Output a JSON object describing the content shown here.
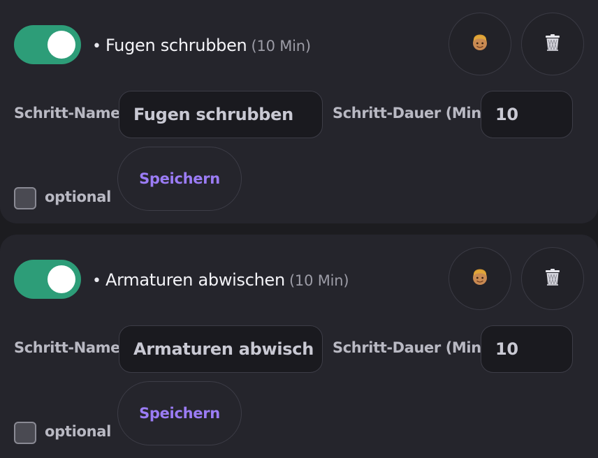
{
  "steps": [
    {
      "enabled": true,
      "title": "Fugen schrubben",
      "duration_text": "(10 Min)",
      "name_label": "Schritt-Name",
      "name_value": "Fugen schrubben",
      "duration_label": "Schritt-Dauer (Min)",
      "duration_value": "10",
      "save_label": "Speichern",
      "optional_label": "optional",
      "optional_checked": false,
      "avatar_icon": "person-avatar-icon",
      "delete_icon": "trash-icon"
    },
    {
      "enabled": true,
      "title": "Armaturen abwischen",
      "duration_text": "(10 Min)",
      "name_label": "Schritt-Name",
      "name_value": "Armaturen abwisch",
      "duration_label": "Schritt-Dauer (Min)",
      "duration_value": "10",
      "save_label": "Speichern",
      "optional_label": "optional",
      "optional_checked": false,
      "avatar_icon": "person-avatar-icon",
      "delete_icon": "trash-icon"
    }
  ],
  "colors": {
    "toggle_on": "#2d9d78",
    "accent_purple": "#9b7cf5",
    "card_bg": "#25252c",
    "page_bg": "#1c1c20"
  }
}
